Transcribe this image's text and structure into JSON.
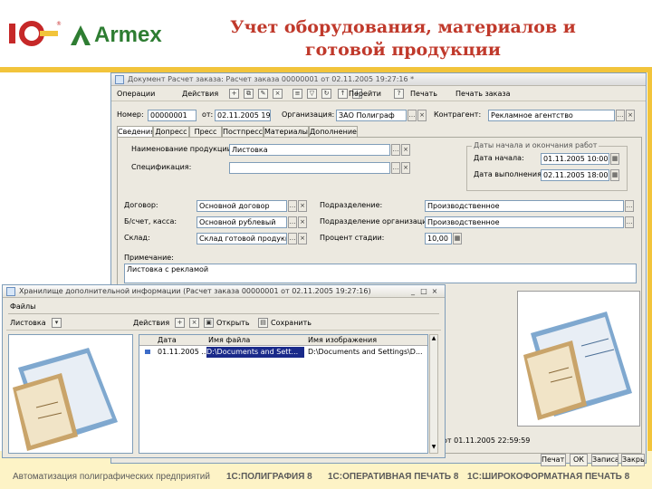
{
  "slide": {
    "title_line1": "Учет оборудования, материалов и",
    "title_line2": "готовой продукции",
    "logo_1c": "1С",
    "logo_armex": "Armex",
    "footer": [
      "Автоматизация полиграфических предприятий",
      "1С:ПОЛИГРАФИЯ 8",
      "1С:ОПЕРАТИВНАЯ ПЕЧАТЬ 8",
      "1С:ШИРОКОФОРМАТНАЯ ПЕЧАТЬ 8"
    ]
  },
  "doc_window": {
    "title": "Документ Расчет заказа: Расчет заказа 00000001 от 02.11.2005 19:27:16 *",
    "toolbar": [
      "Операции",
      "Действия",
      "Перейти",
      "Печать",
      "Печать заказа"
    ],
    "fields": {
      "nomer_label": "Номер:",
      "nomer": "00000001",
      "ot_label": "от:",
      "ot": "02.11.2005 19:",
      "org_label": "Организация:",
      "org": "ЗАО Полиграф",
      "kontr_label": "Контрагент:",
      "kontr": "Рекламное агентство"
    },
    "tabs": [
      "Сведения",
      "Допресс",
      "Пресс",
      "Постпресс",
      "Материалы",
      "Дополнение"
    ],
    "naim_label": "Наименование продукции:",
    "naim": "Листовка",
    "spec_label": "Спецификация:",
    "spec": "",
    "dates_group": "Даты начала и окончания работ",
    "date_start_label": "Дата начала:",
    "date_start": "01.11.2005 10:00:0",
    "date_end_label": "Дата выполнения:",
    "date_end": "02.11.2005 18:00:0",
    "dogovor_label": "Договор:",
    "dogovor": "Основной договор",
    "bschet_label": "Б/счет, касса:",
    "bschet": "Основной рублевый",
    "sklad_label": "Склад:",
    "sklad": "Склад готовой продукции",
    "podr_label": "Подразделение:",
    "podr": "Производственное",
    "podr_org_label": "Подразделение организации:",
    "podr_org": "Производственное",
    "stadia_label": "Процент стадии:",
    "stadia": "10,00",
    "prim_label": "Примечание:",
    "prim": "Листовка с рекламой",
    "bottom_status": "от 01.11.2005 22:59:59",
    "bottom_buttons": [
      "Печать",
      "ОК",
      "Записать",
      "Закрыть"
    ]
  },
  "store_window": {
    "title": "Хранилище дополнительной информации (Расчет заказа 00000001 от 02.11.2005 19:27:16)",
    "group": "Файлы",
    "toolbar_left": "Листовка",
    "toolbar_right": [
      "Действия",
      "Открыть",
      "Сохранить"
    ],
    "columns": [
      "Дата",
      "Имя файла",
      "Имя изображения"
    ],
    "rows": [
      {
        "date": "01.11.2005 ...",
        "file": "D:\\Documents and Sett...",
        "image": "D:\\Documents and Settings\\D..."
      }
    ]
  },
  "colors": {
    "title": "#c0392b",
    "gold": "#f2c43b",
    "selection": "#1a2a8a",
    "brand_green": "#2e7d32",
    "brand_red": "#c62828"
  }
}
